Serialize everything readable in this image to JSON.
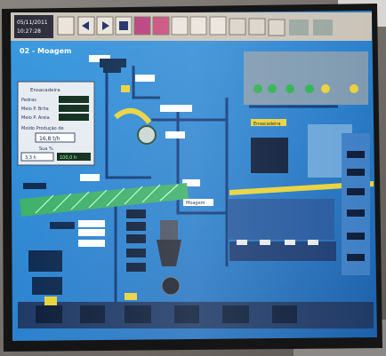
{
  "monitor": {
    "clock_date": "05/11/2011",
    "clock_time": "10:27:28",
    "screen_title": "02 - Moagem"
  },
  "left_panel": {
    "heading": "Ensacadeira",
    "rows": [
      "Pedras",
      "Meio P. Brita",
      "Meio P. Areia"
    ],
    "section": "Moído Produção de",
    "big_value": "16,8 t/h",
    "footer_label": "Sua %",
    "footer_values": [
      "3,3 h",
      "100,0 h"
    ]
  },
  "labels": {
    "mid_tag": "Moagem",
    "right_tag": "Ensacadeira"
  },
  "colors": {
    "screen_blue": "#2f8fd8",
    "deep_blue": "#123a7a",
    "pipe_green": "#3fb06a",
    "bezel": "#1a1a1a",
    "accent_yellow": "#e8d23a"
  },
  "icons": [
    "clock-icon",
    "save-icon",
    "back-icon",
    "forward-icon",
    "print-icon",
    "alarm-icon",
    "trend-icon",
    "report-icon",
    "settings-icon",
    "help-icon"
  ]
}
